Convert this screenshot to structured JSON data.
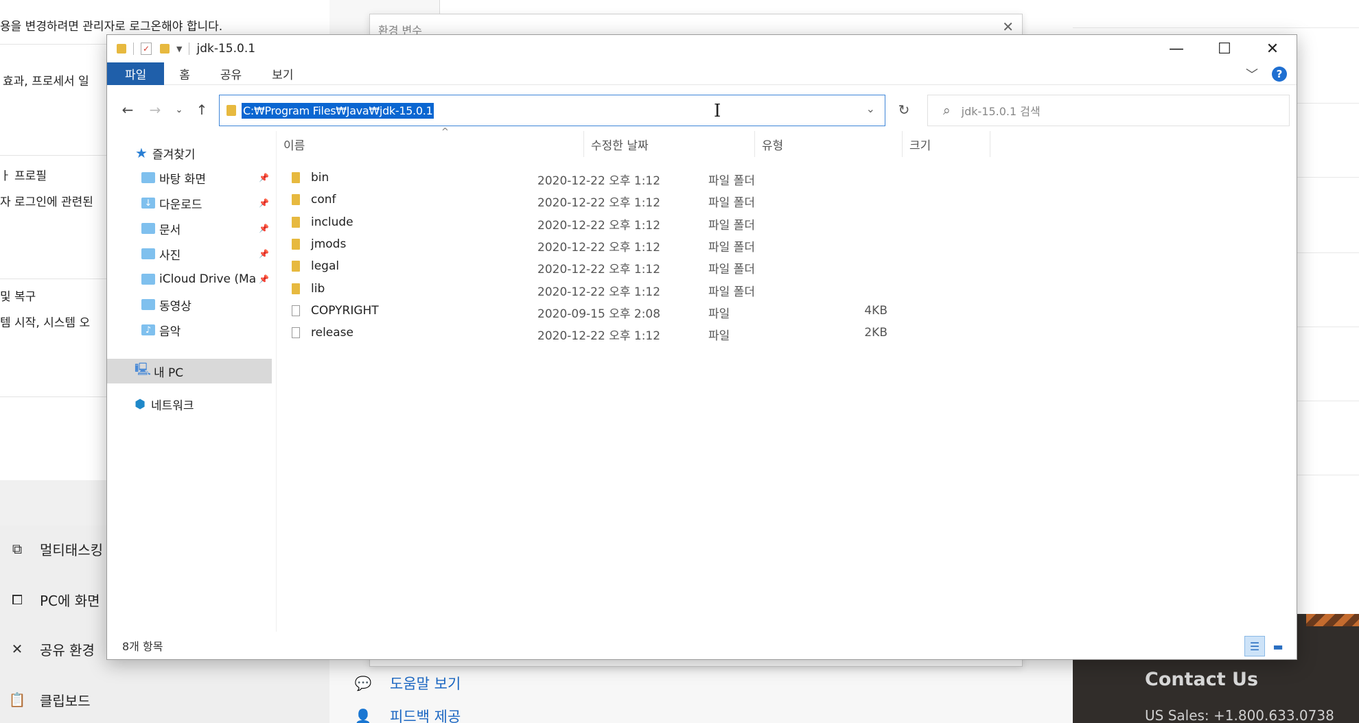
{
  "background": {
    "settings": {
      "lines": [
        "용을 변경하려면 관리자로 로그온해야 합니다.",
        "효과, 프로세서 일",
        "ㅏ 프로필",
        "자 로그인에 관련된",
        "및 복구",
        "템 시작, 시스템 오"
      ],
      "nav": [
        "멀티태스킹",
        "PC에 화면",
        "공유 환경",
        "클립보드"
      ]
    },
    "env_dialog": {
      "title": "환경 변수"
    },
    "help_links": [
      "도움말 보기",
      "피드백 제공"
    ],
    "contact": {
      "title": "Contact Us",
      "phone": "US Sales: +1.800.633.0738"
    }
  },
  "window": {
    "title": "jdk-15.0.1",
    "ribbon_tabs": [
      "파일",
      "홈",
      "공유",
      "보기"
    ],
    "address": "C:₩Program Files₩Java₩jdk-15.0.1",
    "search_placeholder": "jdk-15.0.1 검색",
    "nav_pane": {
      "quick_access": "즐겨찾기",
      "items": [
        {
          "label": "바탕 화면",
          "pinned": true
        },
        {
          "label": "다운로드",
          "pinned": true
        },
        {
          "label": "문서",
          "pinned": true
        },
        {
          "label": "사진",
          "pinned": true
        },
        {
          "label": "iCloud Drive (Ma",
          "pinned": true
        },
        {
          "label": "동영상",
          "pinned": false
        },
        {
          "label": "음악",
          "pinned": false
        }
      ],
      "this_pc": "내 PC",
      "network": "네트워크"
    },
    "columns": {
      "name": "이름",
      "date": "수정한 날짜",
      "type": "유형",
      "size": "크기"
    },
    "files": [
      {
        "name": "bin",
        "date": "2020-12-22 오후 1:12",
        "type": "파일 폴더",
        "size": "",
        "kind": "folder"
      },
      {
        "name": "conf",
        "date": "2020-12-22 오후 1:12",
        "type": "파일 폴더",
        "size": "",
        "kind": "folder"
      },
      {
        "name": "include",
        "date": "2020-12-22 오후 1:12",
        "type": "파일 폴더",
        "size": "",
        "kind": "folder"
      },
      {
        "name": "jmods",
        "date": "2020-12-22 오후 1:12",
        "type": "파일 폴더",
        "size": "",
        "kind": "folder"
      },
      {
        "name": "legal",
        "date": "2020-12-22 오후 1:12",
        "type": "파일 폴더",
        "size": "",
        "kind": "folder"
      },
      {
        "name": "lib",
        "date": "2020-12-22 오후 1:12",
        "type": "파일 폴더",
        "size": "",
        "kind": "folder"
      },
      {
        "name": "COPYRIGHT",
        "date": "2020-09-15 오후 2:08",
        "type": "파일",
        "size": "4KB",
        "kind": "file"
      },
      {
        "name": "release",
        "date": "2020-12-22 오후 1:12",
        "type": "파일",
        "size": "2KB",
        "kind": "file"
      }
    ],
    "status": "8개 항목",
    "accent": "#1f5faa",
    "icons": {
      "back": "arrow-left-icon",
      "forward": "arrow-right-icon",
      "recent": "chevron-down-icon",
      "up": "arrow-up-icon",
      "refresh": "refresh-icon",
      "search": "search-icon"
    }
  }
}
